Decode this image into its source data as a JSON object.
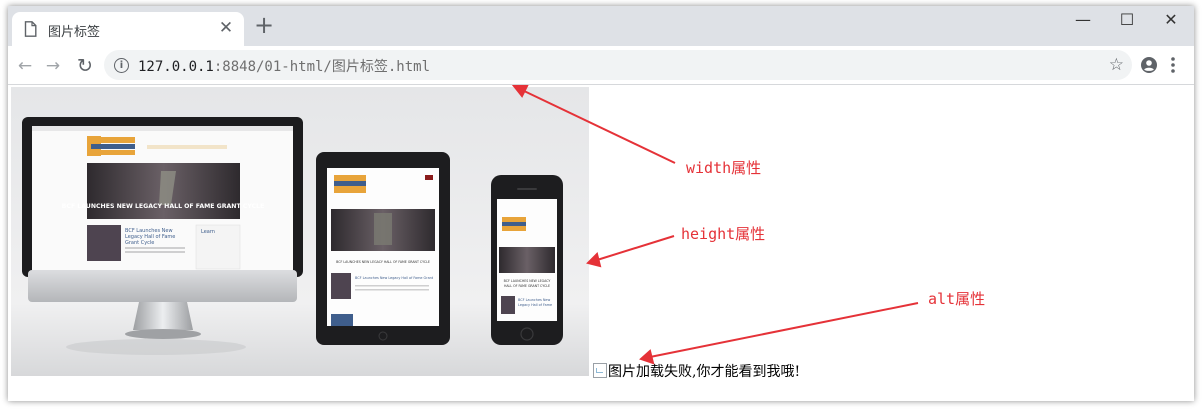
{
  "tab": {
    "title": "图片标签",
    "close_glyph": "✕",
    "new_glyph": "+"
  },
  "window_controls": {
    "minimize": "—",
    "maximize": "☐",
    "close": "✕"
  },
  "nav": {
    "back": "←",
    "forward": "→",
    "reload": "↻"
  },
  "address": {
    "host": "127.0.0.1",
    "rest": ":8848/01-html/图片标签.html",
    "info": "i"
  },
  "bookmark_glyph": "☆",
  "image": {
    "alt_text": "图片加载失败,你才能看到我哦!"
  },
  "mockup": {
    "brand_lines": [
      "BARTLESVILLE",
      "COMMUNITY",
      "FOUNDATION"
    ],
    "brand_tag": "THE POWER OF TOGETHER",
    "nav_links": [
      "Learn",
      "Give",
      "Grab",
      "Hall of Fame",
      "Contact"
    ],
    "banner_text": "BCF LAUNCHES NEW LEGACY HALL OF FAME GRANT CYCLE",
    "headline": "BCF Launches New Legacy Hall of Fame Grant Cycle",
    "side_title": "Learn",
    "tablet_story2": "BCF Requests Proposals for Fleet Philanthropy",
    "phone_caption": "BCF LAUNCHES NEW LEGACY HALL OF FAME GRANT CYCLE"
  },
  "annotations": {
    "width": "width属性",
    "height": "height属性",
    "alt": "alt属性"
  },
  "colors": {
    "annotation": "#e53238",
    "titlebar": "#dee1e6",
    "brand_orange": "#e8a43a",
    "brand_blue": "#3f5e8c"
  }
}
